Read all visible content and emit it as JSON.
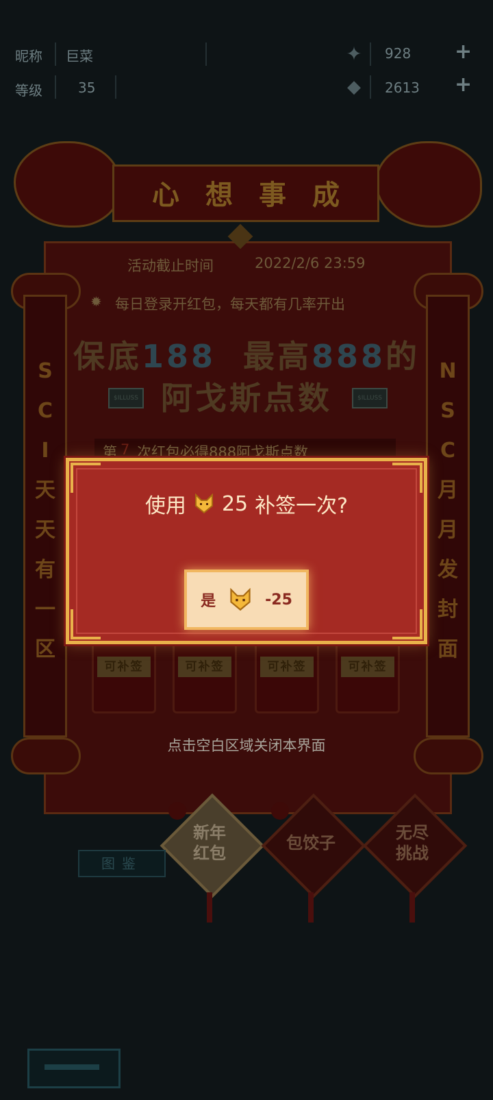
{
  "header": {
    "nickname_label": "昵称",
    "nickname_value": "巨菜",
    "level_label": "等级",
    "level_value": "35",
    "currency1_value": "928",
    "currency2_value": "2613",
    "plus_symbol": "+"
  },
  "banner": {
    "title": "心想事成"
  },
  "event": {
    "deadline_label": "活动截止时间",
    "deadline_value": "2022/2/6 23:59",
    "daily_tip": "每日登录开红包，每天都有几率开出",
    "headline_line1_a": "保底",
    "headline_line1_b": "188",
    "headline_line1_c": "最高",
    "headline_line1_d": "888",
    "headline_line1_e": "的",
    "headline_line2": "阿戈斯点数",
    "guarantee_prefix": "第",
    "guarantee_number": "7",
    "guarantee_text": "次红包必得888阿戈斯点数",
    "badge_text": "$ILLUSS"
  },
  "pillars": {
    "left": [
      "S",
      "C",
      "I",
      "天",
      "天",
      "有",
      "一",
      "区"
    ],
    "right": [
      "N",
      "S",
      "C",
      "月",
      "月",
      "发",
      "封",
      "面"
    ]
  },
  "slots": [
    {
      "label": "可补签"
    },
    {
      "label": "可补签"
    },
    {
      "label": "可补签"
    },
    {
      "label": "可补签"
    }
  ],
  "close_hint": "点击空白区域关闭本界面",
  "dialog": {
    "prefix": "使用",
    "amount": "25",
    "suffix": "补签一次?",
    "confirm_label": "是",
    "confirm_cost": "-25",
    "icon": "fox-coin-icon"
  },
  "menu": [
    {
      "label": "新年\n红包"
    },
    {
      "label": "包饺子"
    },
    {
      "label": "无尽\n挑战"
    }
  ],
  "album_label": "图鉴",
  "colors": {
    "dialog_bg": "#a52a23",
    "dialog_border": "#e9b24a",
    "confirm_bg": "#f8dcb5",
    "dialog_text": "#fde8c6"
  }
}
